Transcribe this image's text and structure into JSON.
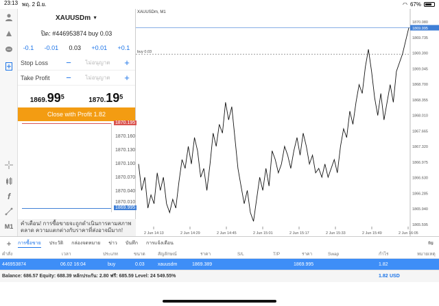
{
  "status": {
    "time": "23:13",
    "date": "พฤ. 2 มิ.ย.",
    "battery": "67%"
  },
  "order_panel": {
    "symbol": "XAUUSDm",
    "order_title": "ปิด: #446953874 buy 0.03",
    "steps": [
      "-0.1",
      "-0.01",
      "0.03",
      "+0.01",
      "+0.1"
    ],
    "stop_loss": {
      "label": "Stop Loss",
      "placeholder": "ไม่อนุญาต"
    },
    "take_profit": {
      "label": "Take Profit",
      "placeholder": "ไม่อนุญาต"
    },
    "bid": {
      "main": "1869.",
      "big": "99",
      "sup": "5"
    },
    "ask": {
      "main": "1870.",
      "big": "19",
      "sup": "5"
    },
    "close_button": "Close with Profit 1.82",
    "mini_levels": [
      "1870.190",
      "1870.160",
      "1870.130",
      "1870.100",
      "1870.070",
      "1870.040",
      "1870.010"
    ],
    "mini_ask_tag": "1870.195",
    "mini_bid_tag": "1869.995",
    "warning": "คำเตือน! การซื้อขายจะถูกดำเนินการตามสภาพตลาด ความแตกต่างกับราคาที่ส่งอาจมีมาก!"
  },
  "chart": {
    "title": "XAUUSDm, M1",
    "price_tag": "1869.995",
    "buy_label": "buy 0.03",
    "y_labels": [
      "1870.080",
      "1869.735",
      "1869.390",
      "1869.045",
      "1868.700",
      "1868.355",
      "1868.010",
      "1867.665",
      "1867.320",
      "1866.975",
      "1866.630",
      "1866.285",
      "1865.940",
      "1865.595"
    ],
    "x_labels": [
      "2 Jun 14:13",
      "2 Jun 14:29",
      "2 Jun 14:45",
      "2 Jun 15:01",
      "2 Jun 15:17",
      "2 Jun 15:33",
      "2 Jun 15:49",
      "2 Jun 16:05"
    ]
  },
  "chart_data": {
    "type": "line",
    "title": "XAUUSDm, M1",
    "xlabel": "",
    "ylabel": "",
    "ylim": [
      1865.45,
      1870.2
    ],
    "series": [
      {
        "values": [
          1866.9,
          1866.3,
          1866.6,
          1865.9,
          1866.2,
          1866.0,
          1866.7,
          1866.3,
          1866.6,
          1866.0,
          1865.8,
          1866.1,
          1865.9,
          1866.5,
          1867.0,
          1866.8,
          1867.3,
          1866.9,
          1867.5,
          1867.2,
          1866.6,
          1866.8,
          1866.3,
          1866.9,
          1867.6,
          1867.3,
          1867.8,
          1867.6,
          1868.3,
          1867.9,
          1868.2,
          1867.5,
          1866.8,
          1866.4,
          1866.0,
          1866.3,
          1865.8,
          1865.6,
          1866.1,
          1866.6,
          1866.3,
          1866.8,
          1866.4,
          1867.2,
          1867.0,
          1866.7,
          1866.9,
          1867.3,
          1867.1,
          1866.8,
          1867.2,
          1867.5,
          1867.1,
          1867.6,
          1867.3,
          1866.9,
          1867.1,
          1866.7,
          1866.8,
          1866.6,
          1866.9,
          1866.6,
          1866.8,
          1867.0,
          1866.7,
          1867.3,
          1867.7,
          1867.5,
          1868.1,
          1867.8,
          1868.3,
          1868.7,
          1868.5,
          1869.1,
          1869.5,
          1869.0,
          1868.4,
          1868.0,
          1868.5,
          1867.9,
          1868.3,
          1868.7,
          1868.3,
          1869.0,
          1869.2,
          1869.4,
          1869.7,
          1869.99
        ]
      }
    ]
  },
  "tabs": [
    "การซื้อขาย",
    "ประวัติ",
    "กล่องจดหมาย",
    "ข่าว",
    "บันทึก",
    "การแจ้งเตือน"
  ],
  "table": {
    "headers": [
      "คำสั่ง",
      "เวลา",
      "ประเภท",
      "ขนาด",
      "สัญลักษณ์",
      "ราคา",
      "S/L",
      "T/P",
      "ราคา",
      "Swap",
      "กำไร",
      "หมายเหตุ"
    ],
    "row": [
      "446953874",
      "06.02 16:04",
      "buy",
      "0.03",
      "xauusdm",
      "1869.389",
      "",
      "",
      "1869.995",
      "",
      "1.82",
      ""
    ]
  },
  "balance": {
    "text": "Balance: 686.57 Equity: 688.39 หลักประกัน: 2.80 ฟรี: 685.59 Level: 24 549.55%",
    "profit": "1.82",
    "currency": "USD"
  }
}
